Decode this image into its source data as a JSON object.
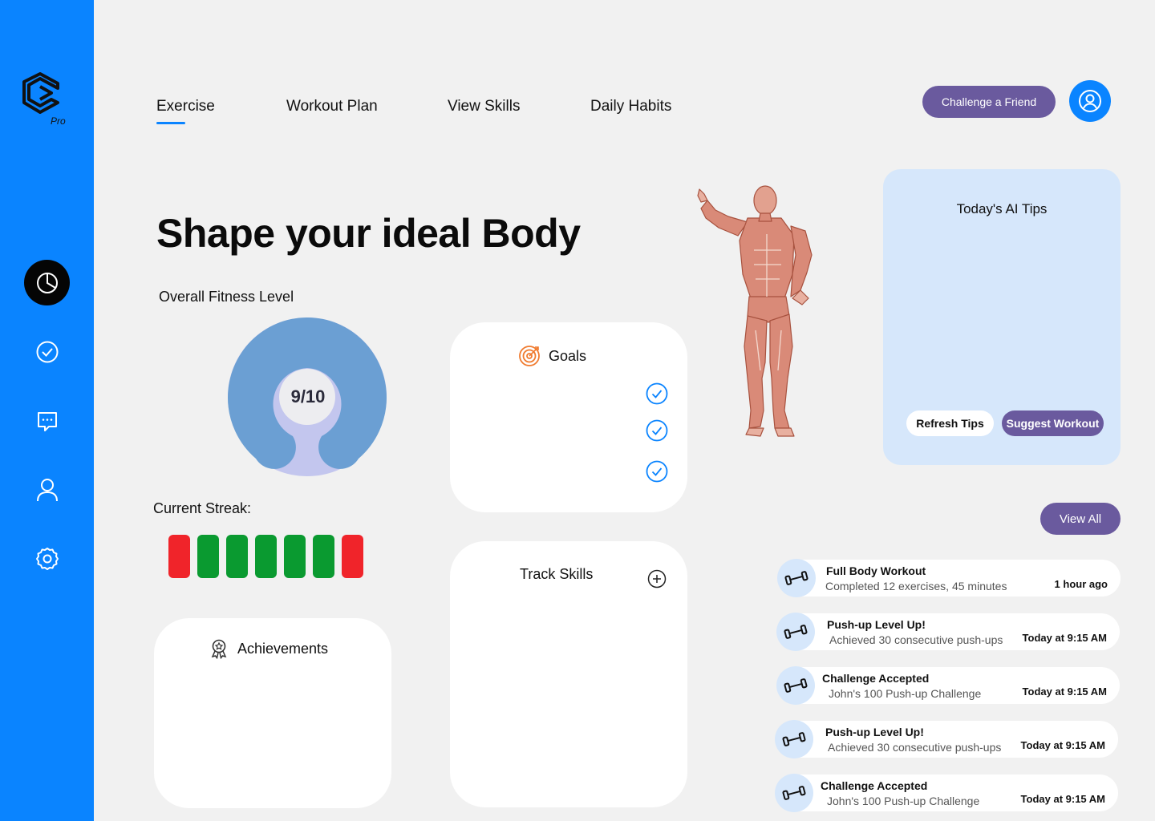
{
  "brand": {
    "badge": "Pro"
  },
  "nav": {
    "tabs": [
      {
        "label": "Exercise",
        "active": true
      },
      {
        "label": "Workout Plan",
        "active": false
      },
      {
        "label": "View Skills",
        "active": false
      },
      {
        "label": "Daily Habits",
        "active": false
      }
    ],
    "challenge_label": "Challenge a Friend"
  },
  "sidebar": {
    "items": [
      "dashboard-icon",
      "check-circle-icon",
      "chat-icon",
      "user-icon",
      "settings-icon"
    ]
  },
  "hero": {
    "title": "Shape your ideal Body"
  },
  "fitness": {
    "label": "Overall Fitness Level",
    "score": "9/10",
    "level": 0.9
  },
  "streak": {
    "label": "Current Streak:",
    "days": [
      "missed",
      "done",
      "done",
      "done",
      "done",
      "done",
      "missed"
    ]
  },
  "goals": {
    "title": "Goals",
    "checks": 3
  },
  "achievements": {
    "title": "Achievements"
  },
  "skills": {
    "title": "Track Skills"
  },
  "ai_tips": {
    "title": "Today's AI Tips",
    "refresh_label": "Refresh Tips",
    "suggest_label": "Suggest Workout"
  },
  "activity": {
    "view_all_label": "View All",
    "items": [
      {
        "title": "Full Body Workout",
        "subtitle": "Completed 12 exercises, 45 minutes",
        "time": "1 hour ago"
      },
      {
        "title": "Push-up Level Up!",
        "subtitle": "Achieved 30 consecutive push-ups",
        "time": "Today at 9:15 AM"
      },
      {
        "title": "Challenge Accepted",
        "subtitle": "John's 100 Push-up Challenge",
        "time": "Today at 9:15 AM"
      },
      {
        "title": "Push-up Level Up!",
        "subtitle": "Achieved 30 consecutive push-ups",
        "time": "Today at 9:15 AM"
      },
      {
        "title": "Challenge Accepted",
        "subtitle": "John's 100 Push-up Challenge",
        "time": "Today at 9:15 AM"
      }
    ]
  },
  "colors": {
    "primary": "#0a84ff",
    "accent": "#6a5a9e",
    "streak_done": "#0a9a30",
    "streak_missed": "#f0242a",
    "gauge": "#6b9fd3",
    "gauge_track": "#c3c6ee",
    "tips_bg": "#d6e7fb"
  }
}
